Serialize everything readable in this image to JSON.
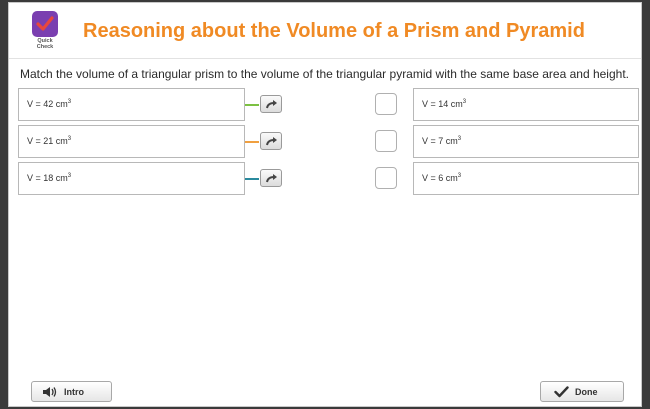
{
  "header": {
    "badge_line1": "Quick",
    "badge_line2": "Check",
    "title": "Reasoning about the Volume of a Prism and Pyramid"
  },
  "instructions": "Match the volume of a triangular prism to the volume of the triangular pyramid with the same base area and height.",
  "left_items": [
    {
      "prefix": "V = 42 cm",
      "exp": "3",
      "connector_color": "#7cc142"
    },
    {
      "prefix": "V = 21 cm",
      "exp": "3",
      "connector_color": "#f0a040"
    },
    {
      "prefix": "V = 18 cm",
      "exp": "3",
      "connector_color": "#2a8a9e"
    }
  ],
  "right_items": [
    {
      "prefix": "V = 14 cm",
      "exp": "3"
    },
    {
      "prefix": "V = 7 cm",
      "exp": "3"
    },
    {
      "prefix": "V = 6 cm",
      "exp": "3"
    }
  ],
  "footer": {
    "intro_label": "Intro",
    "done_label": "Done"
  },
  "icons": {
    "badge": "check-icon",
    "arrow": "curved-arrow-icon",
    "intro": "speaker-icon",
    "done": "check-icon"
  },
  "colors": {
    "title": "#f08a24",
    "badge": "#7a3fb0"
  }
}
